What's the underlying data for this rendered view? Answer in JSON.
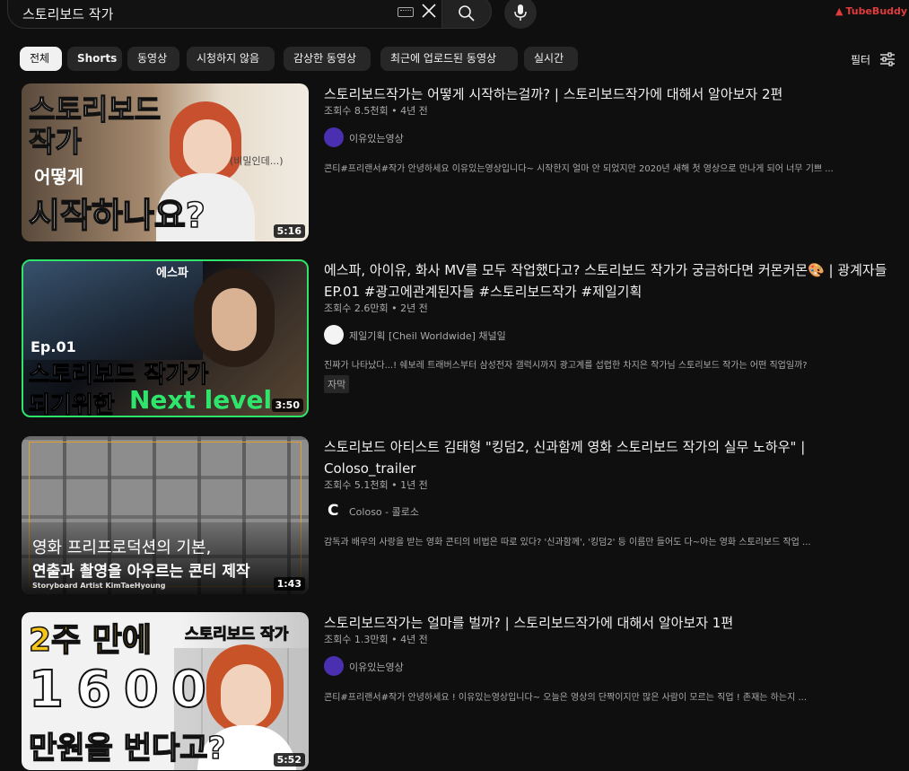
{
  "search": {
    "query": "스토리보드 작가"
  },
  "extension": {
    "label": "TubeBuddy S"
  },
  "chips": [
    {
      "label": "전체"
    },
    {
      "label": "Shorts"
    },
    {
      "label": "동영상"
    },
    {
      "label": "시청하지 않음"
    },
    {
      "label": "감상한 동영상"
    },
    {
      "label": "최근에 업로드된 동영상"
    },
    {
      "label": "실시간"
    }
  ],
  "filter_label": "필터",
  "results": [
    {
      "title": "스토리보드작가는 어떻게 시작하는걸까? | 스토리보드작가에 대해서 알아보자 2편",
      "meta": "조회수 8.5천회 • 4년 전",
      "channel": "이유있는영상",
      "description": "콘티#프리랜서#작가 안녕하세요 이유있는영상입니다~ 시작한지 얼마 안 되었지만 2020년 새해 첫 영상으로 만나게 되어 너무 기쁘 ...",
      "duration": "5:16",
      "thumb_lines": [
        "스토리보드",
        "작가",
        "어떻게",
        "시작하나요?",
        "(비밀인데...)"
      ]
    },
    {
      "title": "에스파, 아이유, 화사 MV를 모두 작업했다고? 스토리보드 작가가 궁금하다면 커몬커몬🎨 | 광계자들 EP.01 #광고에관계된자들 #스토리보드작가 #제일기획",
      "meta": "조회수 2.6만회 • 2년 전",
      "channel": "제일기획 [Cheil Worldwide] 채널일",
      "description": "진짜가 나타났다...! 쉐보레 트래버스부터 삼성전자 갤럭시까지 광고계를 섭렵한 차지은 작가님 스토리보드 작가는 어떤 직업일까?",
      "badge": "자막",
      "duration": "3:50",
      "thumb_lines": [
        "Ep.01",
        "스토리보드 작가가",
        "되기위한",
        "Next level",
        "에스파"
      ]
    },
    {
      "title": "스토리보드 아티스트 김태형 \"킹덤2, 신과함께 영화 스토리보드 작가의 실무 노하우\" | Coloso_trailer",
      "meta": "조회수 5.1천회 • 1년 전",
      "channel": "Coloso - 콜로소",
      "description": "감독과 배우의 사랑을 받는 영화 콘티의 비법은 따로 있다? '신과함께', '킹덤2' 등 이름만 들어도 다~아는 영화 스토리보드 작업 ...",
      "duration": "1:43",
      "thumb_lines": [
        "영화 프리프로덕션의 기본,",
        "연출과 촬영을 아우르는 콘티 제작",
        "Storyboard Artist KimTaeHyoung"
      ]
    },
    {
      "title": "스토리보드작가는 얼마를 벌까? | 스토리보드작가에 대해서 알아보자 1편",
      "meta": "조회수 1.3만회 • 4년 전",
      "channel": "이유있는영상",
      "description": "콘티#프리랜서#작가 안녕하세요 ! 이유있는영상입니다~ 오늘은 영상의 단짝이지만 많은 사람이 모르는 직업 ! 존재는 하는지 ...",
      "duration": "5:52",
      "thumb_lines": [
        "2주 만에",
        "스토리보드 작가",
        "1600",
        "만원을 번다고?"
      ]
    }
  ]
}
